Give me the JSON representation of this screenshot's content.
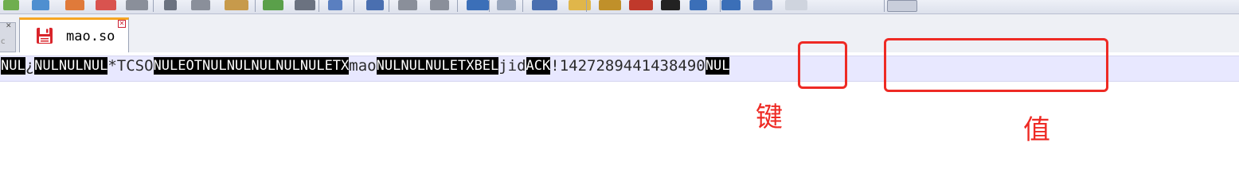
{
  "toolbar": {
    "icons": [
      "new-file-icon",
      "open-file-icon",
      "save-icon",
      "save-all-icon",
      "print-icon",
      "cut-icon",
      "copy-icon",
      "paste-icon",
      "undo-icon",
      "redo-icon",
      "find-icon",
      "replace-icon",
      "zoom-in-icon",
      "zoom-out-icon",
      "sync-icon",
      "wrap-icon",
      "indent-icon",
      "bookmark-icon",
      "macro-icon",
      "record-icon",
      "stop-icon",
      "play-icon",
      "play-multi-icon",
      "save-macro-icon",
      "panel-icon"
    ]
  },
  "tabs": [
    {
      "label": "mao.so",
      "active": true
    }
  ],
  "editor": {
    "tokens": [
      {
        "t": "NUL",
        "ctrl": true
      },
      {
        "t": "¿",
        "ctrl": false
      },
      {
        "t": "NUL",
        "ctrl": true
      },
      {
        "t": "NUL",
        "ctrl": true
      },
      {
        "t": "NUL",
        "ctrl": true
      },
      {
        "t": "*TCSO",
        "ctrl": false
      },
      {
        "t": "NUL",
        "ctrl": true
      },
      {
        "t": "EOT",
        "ctrl": true
      },
      {
        "t": "NUL",
        "ctrl": true
      },
      {
        "t": "NUL",
        "ctrl": true
      },
      {
        "t": "NUL",
        "ctrl": true
      },
      {
        "t": "NUL",
        "ctrl": true
      },
      {
        "t": "NUL",
        "ctrl": true
      },
      {
        "t": "ETX",
        "ctrl": true
      },
      {
        "t": "mao",
        "ctrl": false
      },
      {
        "t": "NUL",
        "ctrl": true
      },
      {
        "t": "NUL",
        "ctrl": true
      },
      {
        "t": "NUL",
        "ctrl": true
      },
      {
        "t": "ETX",
        "ctrl": true
      },
      {
        "t": "BEL",
        "ctrl": true
      },
      {
        "t": "jid",
        "ctrl": false
      },
      {
        "t": "ACK",
        "ctrl": true
      },
      {
        "t": "!",
        "ctrl": false
      },
      {
        "t": "1427289441438490",
        "ctrl": false
      },
      {
        "t": "NUL",
        "ctrl": true
      }
    ]
  },
  "annotations": {
    "key_label": "键",
    "value_label": "值"
  },
  "colors": {
    "highlight": "#ee2a24",
    "current_line": "#e8e8ff",
    "control_char_bg": "#000000",
    "tab_accent": "#f6a623"
  }
}
